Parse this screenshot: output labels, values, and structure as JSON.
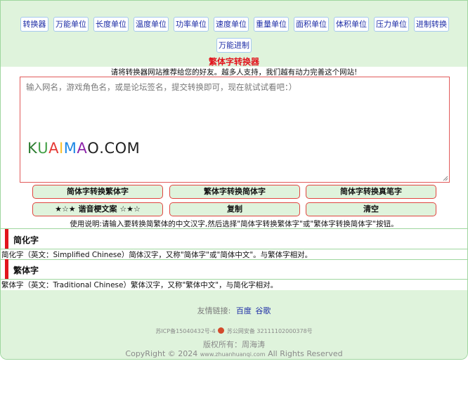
{
  "nav": {
    "items": [
      "转换器",
      "万能单位",
      "长度单位",
      "温度单位",
      "功率单位",
      "速度单位",
      "重量单位",
      "面积单位",
      "体积单位",
      "压力单位",
      "进制转换",
      "万能进制"
    ]
  },
  "title": "繁体字转换器",
  "subtitle": "请将转换器网站推荐给您的好友。越多人支持，我们越有动力完善这个网站!",
  "input": {
    "placeholder": "输入网名，游戏角色名，或是论坛签名，提交转换即可，现在就试试看吧：）"
  },
  "logo": {
    "text": "KUAIMAO.COM",
    "colors": [
      "#2e7d32",
      "#43a047",
      "#e53935",
      "#fbc02d",
      "#1e88e5",
      "#8e24aa",
      "#222222",
      "#222222",
      "#222222",
      "#222222",
      "#222222"
    ]
  },
  "actions": {
    "row1": [
      "简体字转换繁体字",
      "繁体字转换简体字",
      "简体字转换真笔字"
    ],
    "row2": [
      "★☆★ 谐音梗文案 ☆★☆",
      "复制",
      "清空"
    ]
  },
  "usage": "使用说明:请输入要转换简繁体的中文汉字,然后选择\"简体字转换繁体字\"或\"繁体字转换简体字\"按钮。",
  "sections": [
    {
      "title": "简化字",
      "text": "简化字（英文：Simplified Chinese）简体汉字，又称\"简体字\"或\"简体中文\"。与繁体字相对。"
    },
    {
      "title": "繁体字",
      "text": "繁体字（英文：Traditional Chinese）繁体汉字，又称\"繁体中文\"，与简化字相对。"
    }
  ],
  "footer": {
    "friend_label": "友情链接:",
    "links": [
      "百度",
      "谷歌"
    ],
    "icp": "苏ICP备15040432号-4",
    "police": "苏公网安备 32111102000378号",
    "owner": "版权所有：周海涛",
    "copyright_prefix": "CopyRight © 2024",
    "copyright_domain": "www.zhuanhuanqi.com",
    "copyright_suffix": "All Rights Reserved"
  },
  "colors": {
    "nav_bg": "#dff3dc",
    "title_red": "#e2131c",
    "link_blue": "#1d2ca6",
    "border_red": "#e0453f",
    "border_green": "#9ed69e"
  }
}
